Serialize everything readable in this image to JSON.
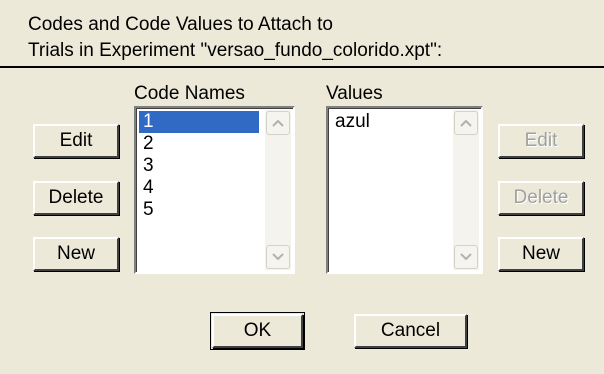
{
  "header": {
    "line1": "Codes and Code Values to Attach to",
    "line2": "Trials in Experiment \"versao_fundo_colorido.xpt\":"
  },
  "code_names": {
    "label": "Code Names",
    "items": [
      "1",
      "2",
      "3",
      "4",
      "5"
    ],
    "selected": "1"
  },
  "values": {
    "label": "Values",
    "items": [
      "azul"
    ]
  },
  "left_buttons": {
    "edit": "Edit",
    "delete": "Delete",
    "new": "New"
  },
  "right_buttons": {
    "edit": "Edit",
    "delete": "Delete",
    "new": "New"
  },
  "footer": {
    "ok": "OK",
    "cancel": "Cancel"
  },
  "colors": {
    "dialog_bg": "#ece9d8",
    "selection": "#316ac5",
    "disabled_text": "#a0a0a0"
  }
}
